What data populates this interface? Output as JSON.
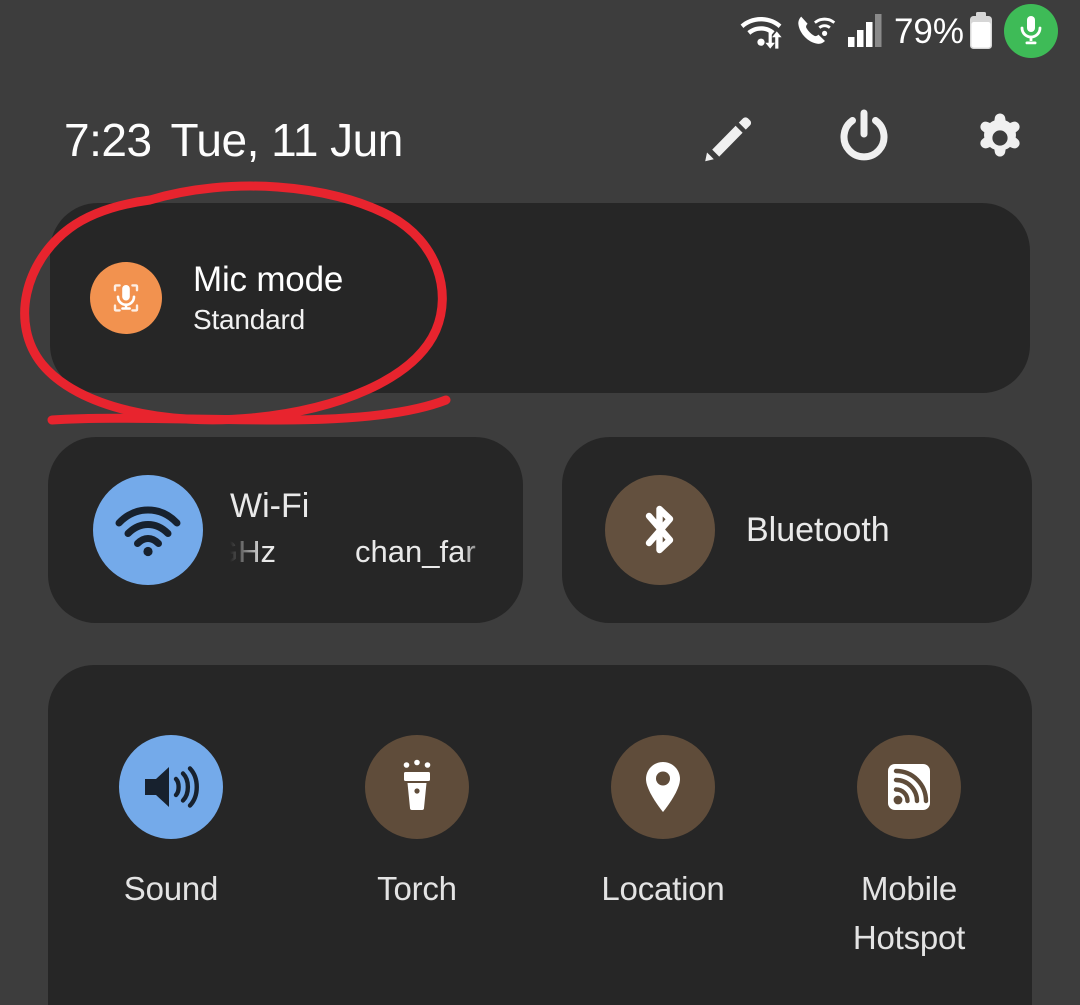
{
  "status_bar": {
    "icons": [
      {
        "name": "wifi-data-transfer-icon",
        "label": "Wi-Fi with up/down data arrows"
      },
      {
        "name": "wifi-calling-icon",
        "label": "Wi-Fi calling"
      },
      {
        "name": "cellular-signal-icon",
        "label": "Mobile signal 3 of 4 bars"
      }
    ],
    "battery_percent": "79%",
    "battery_icon": "battery-icon",
    "mic_indicator_icon": "microphone-privacy-indicator-icon",
    "mic_indicator_color": "#3ebb57"
  },
  "header": {
    "time": "7:23",
    "date": "Tue, 11 Jun",
    "actions": [
      {
        "name": "edit-button",
        "icon": "pencil-icon"
      },
      {
        "name": "power-button",
        "icon": "power-icon"
      },
      {
        "name": "settings-button",
        "icon": "gear-icon"
      }
    ]
  },
  "mic_mode_tile": {
    "title": "Mic mode",
    "subtitle": "Standard",
    "icon": "microphone-icon",
    "icon_color": "#f2924f",
    "active": true
  },
  "connectivity_tiles": [
    {
      "name": "wifi-tile",
      "title": "Wi-Fi",
      "subtitle_fragment_left": "GHz",
      "subtitle_fragment_right": "chan_far",
      "icon": "wifi-icon",
      "icon_color": "#74aaea",
      "active": true
    },
    {
      "name": "bluetooth-tile",
      "title": "Bluetooth",
      "icon": "bluetooth-icon",
      "icon_color": "#63503e",
      "active": false
    }
  ],
  "quick_settings": [
    {
      "label": "Sound",
      "icon": "volume-up-icon",
      "icon_color": "#74aaea",
      "active": true
    },
    {
      "label": "Torch",
      "icon": "flashlight-icon",
      "icon_color": "#5f4c3a",
      "active": false
    },
    {
      "label": "Location",
      "icon": "location-pin-icon",
      "icon_color": "#5f4c3a",
      "active": false
    },
    {
      "label": "Mobile\nHotspot",
      "icon": "hotspot-icon",
      "icon_color": "#5f4c3a",
      "active": false
    }
  ],
  "annotation": {
    "name": "red-circle-annotation",
    "color": "#e8242e",
    "description": "Hand-drawn red ellipse around the Mic mode tile with a trailing stroke"
  },
  "theme": {
    "background": "#3d3d3d",
    "tile_background": "#262626",
    "text_primary": "#ffffff",
    "text_secondary": "#e3e3e3"
  }
}
